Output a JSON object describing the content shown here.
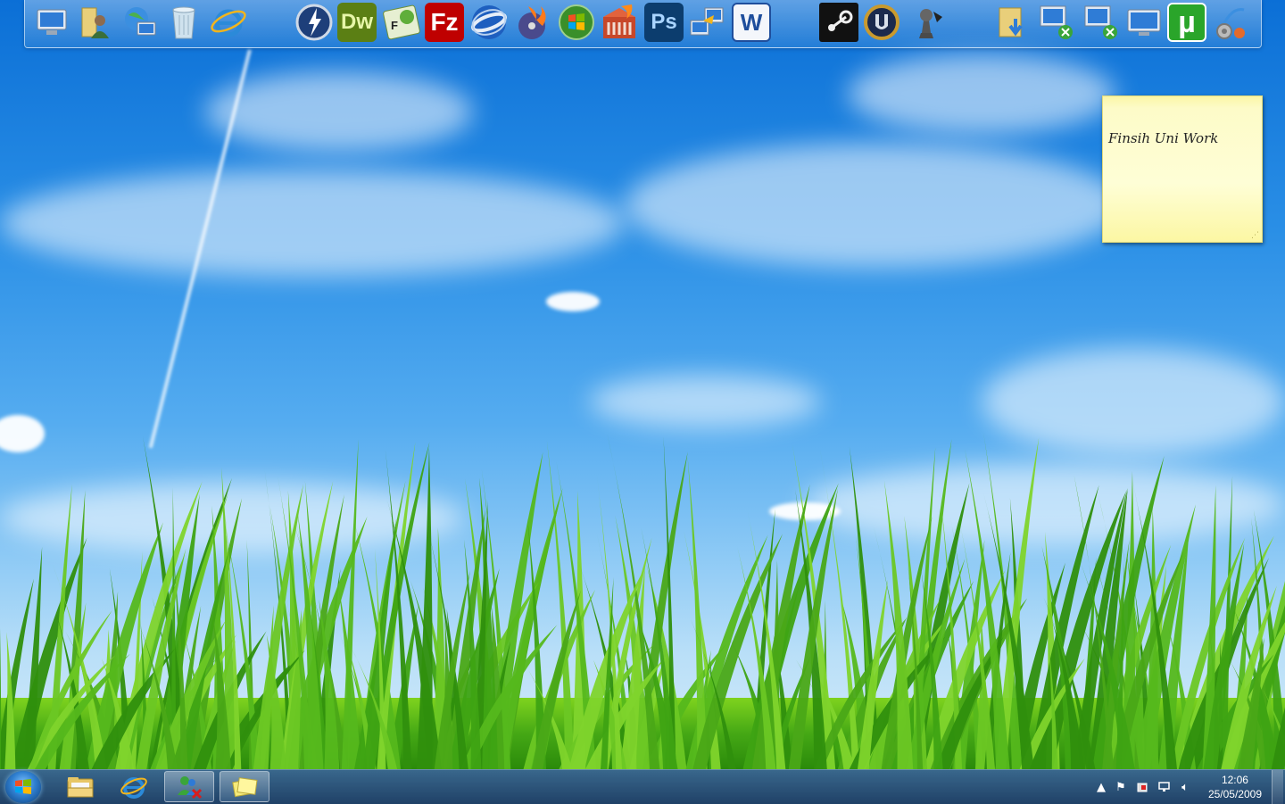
{
  "dock": {
    "icons": [
      {
        "name": "computer-icon"
      },
      {
        "name": "user-folder-icon"
      },
      {
        "name": "network-globe-icon"
      },
      {
        "name": "recycle-bin-icon"
      },
      {
        "name": "internet-explorer-icon"
      },
      {
        "name": "daemon-tools-icon"
      },
      {
        "name": "dreamweaver-icon",
        "label": "Dw"
      },
      {
        "name": "fireworks-icon"
      },
      {
        "name": "filezilla-icon",
        "label": "Fz"
      },
      {
        "name": "google-earth-icon"
      },
      {
        "name": "nero-burning-icon"
      },
      {
        "name": "windows-media-center-icon"
      },
      {
        "name": "nero-startsmart-icon"
      },
      {
        "name": "photoshop-icon",
        "label": "Ps"
      },
      {
        "name": "transfer-wizard-icon"
      },
      {
        "name": "word-icon",
        "label": "W"
      },
      {
        "name": "steam-icon"
      },
      {
        "name": "unreal-tournament-icon"
      },
      {
        "name": "chess-icon"
      },
      {
        "name": "downloads-folder-icon"
      },
      {
        "name": "remote-desktop-icon-1"
      },
      {
        "name": "remote-desktop-icon-2"
      },
      {
        "name": "monitor-icon"
      },
      {
        "name": "utorrent-icon",
        "label": "µ"
      },
      {
        "name": "settings-gears-icon"
      }
    ]
  },
  "sticky_note": {
    "text": "Finsih Uni Work"
  },
  "taskbar": {
    "tray": {
      "time": "12:06",
      "date": "25/05/2009",
      "icons": [
        "show-hidden-icons-arrow",
        "action-center-flag-icon",
        "power-icon",
        "network-icon",
        "volume-icon"
      ]
    }
  },
  "colors": {
    "sky_top": "#0b6fd6",
    "sky_bottom": "#d6ecfa",
    "grass": "#3ea313",
    "sticky": "#fdfbc8",
    "taskbar": "#1f4f7f"
  }
}
